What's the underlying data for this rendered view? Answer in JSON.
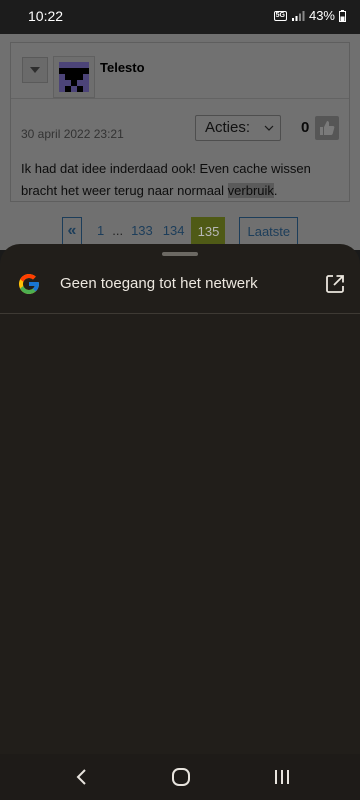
{
  "status_bar": {
    "time": "10:22",
    "network": "5G",
    "battery": "43%"
  },
  "post": {
    "username": "Telesto",
    "date": "30 april 2022 23:21",
    "actions_label": "Acties:",
    "like_count": "0",
    "text_before": "Ik had dat idee inderdaad ook! Even cache wissen bracht het weer terug naar normaal ",
    "text_highlight": "verbruik",
    "text_after": "."
  },
  "pagination": {
    "prev": "«",
    "first": "1",
    "ellipsis": "...",
    "pages": [
      "133",
      "134"
    ],
    "current": "135",
    "last": "Laatste"
  },
  "sheet": {
    "title": "Geen toegang tot het netwerk"
  },
  "icons": {
    "google": "google-g-logo",
    "external": "open-in-new-icon",
    "like": "thumbs-up-icon"
  },
  "colors": {
    "sheet_bg": "#211e1a",
    "current_page": "#4f5a16",
    "link": "#1c3d5a"
  }
}
